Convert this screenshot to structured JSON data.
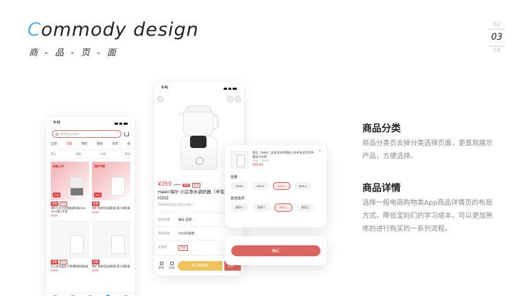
{
  "header": {
    "title_first": "C",
    "title_rest": "ommody design",
    "subtitle": "商 - 品 - 页 - 面"
  },
  "pager": {
    "prev": "02",
    "current": "03",
    "next": "04"
  },
  "phone_category": {
    "time": "9:41",
    "search_placeholder": "搜索商品关键词",
    "categories": [
      "全部",
      "消毒",
      "喂奶",
      "辅食",
      "洗衣",
      "安"
    ],
    "filters": [
      "默认",
      "销量",
      "价格",
      "筛选"
    ],
    "products": [
      {
        "promo_label": "奶瓶上市",
        "badge": "239",
        "tags": [
          "自营",
          "新品"
        ],
        "name": "海尔小白卡奶瓶器调奶器H9M-H201婴儿专用",
        "price": "¥239",
        "style": "promo"
      },
      {
        "promo_label": "调奶专属",
        "badge": "219",
        "tags": [
          "自营"
        ],
        "name": "海尔 智能恒温调奶器 婴儿调奶器",
        "price": "¥219",
        "style": "promo"
      },
      {
        "promo_label": "",
        "badge": "",
        "tags": [
          "自营",
          "新品"
        ],
        "name": "贝立安恒温壶 不锈钢智能调奶器",
        "price": "¥358",
        "style": "plain"
      },
      {
        "promo_label": "",
        "badge": "",
        "tags": [
          "自营"
        ],
        "name": "海尔 智能恒温调奶器 婴儿调奶器",
        "price": "¥279",
        "style": "plain"
      }
    ]
  },
  "phone_detail": {
    "time": "9:41",
    "price": "¥359",
    "old_price": "¥399",
    "tag_fill": "自营",
    "tag_outline": "满减",
    "name": "Haier/海尔 小白净水调奶器（半包）M-H202",
    "desc": "奶粉调奶恒温水平快乐的家人",
    "rows": [
      {
        "k": "选择参数",
        "v": "编号 品牌..."
      },
      {
        "k": "选择规格",
        "v": "2019升级款"
      },
      {
        "k": "优惠券",
        "v": "领券"
      }
    ],
    "icons": [
      "客服",
      "店铺"
    ],
    "cart_label": "加入购物车",
    "buy_label": "立即"
  },
  "spec_popup": {
    "close": "×",
    "title": "努比（Nuby）宝宝学饮杯婴幼儿水杯宝宝学饮杯婴幼儿水杯",
    "stock": "库存：200件",
    "price": "¥99.00",
    "capacity_label": "容量",
    "capacity_options": [
      "300ml",
      "400ml",
      "500ml",
      "600ml"
    ],
    "capacity_selected": 2,
    "other_label": "其他选项",
    "other_options": [
      "选项一",
      "选项二",
      "选项三",
      "选项三"
    ],
    "other_selected": 2,
    "confirm_label": "确定"
  },
  "sections": [
    {
      "heading": "商品分类",
      "body": "商品分类页去掉分类选择页面，更直观展示产品，方便选择。"
    },
    {
      "heading": "商品详情",
      "body": "选择一般电商购物类App商品详情页的布局方式，降低宝妈们的学习成本，可以更加熟练的进行购买的一系列流程。"
    }
  ],
  "colors": {
    "accent_blue": "#54b4f0",
    "brand_red": "#e05050",
    "cart_yellow": "#f0c25a"
  }
}
